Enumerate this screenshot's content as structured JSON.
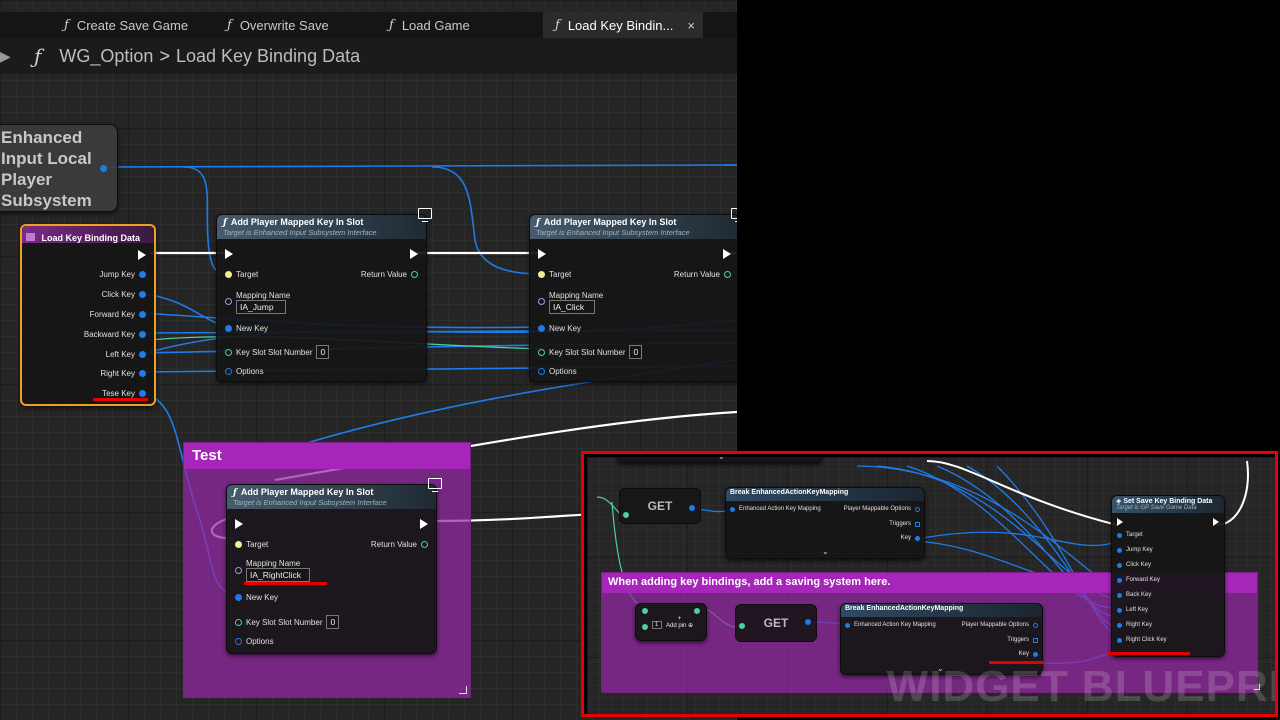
{
  "tabs": [
    {
      "label": "Create Save Game",
      "active": false
    },
    {
      "label": "Overwrite Save",
      "active": false
    },
    {
      "label": "Load Game",
      "active": false
    },
    {
      "label": "Load Key Bindin...",
      "active": true
    }
  ],
  "tab_close_glyph": "×",
  "function_glyph": "ƒ",
  "breadcrumb": {
    "parent": "WG_Option",
    "separator": ">",
    "current": "Load Key Binding Data"
  },
  "subsystem_node": {
    "title": "Enhanced Input Local Player Subsystem"
  },
  "load_node": {
    "title": "Load Key Binding Data",
    "pins": [
      "Jump Key",
      "Click Key",
      "Forward Key",
      "Backward Key",
      "Left Key",
      "Right Key",
      "Tese Key"
    ]
  },
  "add_key_nodes": [
    {
      "title": "Add Player Mapped Key In Slot",
      "subtitle": "Target is Enhanced Input Subsystem Interface",
      "target_label": "Target",
      "return_label": "Return Value",
      "mapping_name_label": "Mapping Name",
      "mapping_name_value": "IA_Jump",
      "new_key_label": "New Key",
      "slot_label": "Key Slot Slot Number",
      "slot_value": "0",
      "options_label": "Options"
    },
    {
      "title": "Add Player Mapped Key In Slot",
      "subtitle": "Target is Enhanced Input Subsystem Interface",
      "target_label": "Target",
      "return_label": "Return Value",
      "mapping_name_label": "Mapping Name",
      "mapping_name_value": "IA_Click",
      "new_key_label": "New Key",
      "slot_label": "Key Slot Slot Number",
      "slot_value": "0",
      "options_label": "Options"
    },
    {
      "title": "Add Player Mapped Key In Slot",
      "subtitle": "Target is Enhanced Input Subsystem Interface",
      "target_label": "Target",
      "return_label": "Return Value",
      "mapping_name_label": "Mapping Name",
      "mapping_name_value": "IA_RightClick",
      "new_key_label": "New Key",
      "slot_label": "Key Slot Slot Number",
      "slot_value": "0",
      "options_label": "Options"
    }
  ],
  "test_comment": {
    "title": "Test"
  },
  "inset": {
    "get_label": "GET",
    "break_node": {
      "title": "Break EnhancedActionKeyMapping",
      "in_pin": "Enhanced Action Key Mapping",
      "options_pin": "Player Mappable Options",
      "triggers_pin": "Triggers",
      "key_pin": "Key"
    },
    "set_node": {
      "title": "Set Save Key Binding Data",
      "subtitle": "Target is GP Save Game Data",
      "pins": [
        "Target",
        "Jump Key",
        "Click Key",
        "Forward Key",
        "Back Key",
        "Left Key",
        "Right Key",
        "Right Click Key"
      ]
    },
    "comment_title": "When adding key bindings, add a saving system here.",
    "add_pin_label": "Add pin",
    "index_value": "1",
    "watermark": "WIDGET BLUEPRI"
  },
  "colors": {
    "highlight_red": "#e40000",
    "comment_purple": "#a526b8",
    "load_node_border": "#f0a020",
    "wire_blue": "#1e7be8",
    "exec_white": "#ffffff"
  }
}
